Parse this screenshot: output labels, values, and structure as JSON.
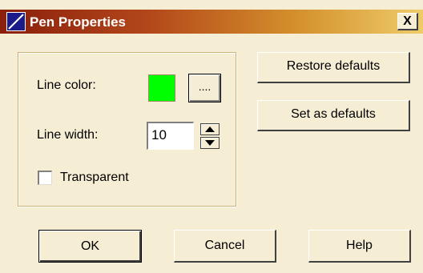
{
  "window": {
    "title": "Pen Properties",
    "close_label": "X"
  },
  "line_color": {
    "label": "Line color:",
    "color": "#00ff00",
    "picker_label": "...."
  },
  "line_width": {
    "label": "Line width:",
    "value": "10"
  },
  "transparent": {
    "label": "Transparent",
    "checked": false
  },
  "buttons": {
    "restore_defaults": "Restore defaults",
    "set_as_defaults": "Set as defaults",
    "ok": "OK",
    "cancel": "Cancel",
    "help": "Help"
  },
  "colors": {
    "face": "#f5edd4",
    "title_start": "#8a1f0c",
    "title_end": "#eecc6a"
  },
  "icons": {
    "title_icon": "pen-line-icon",
    "close": "close-icon",
    "spin_up": "triangle-up-icon",
    "spin_down": "triangle-down-icon"
  }
}
